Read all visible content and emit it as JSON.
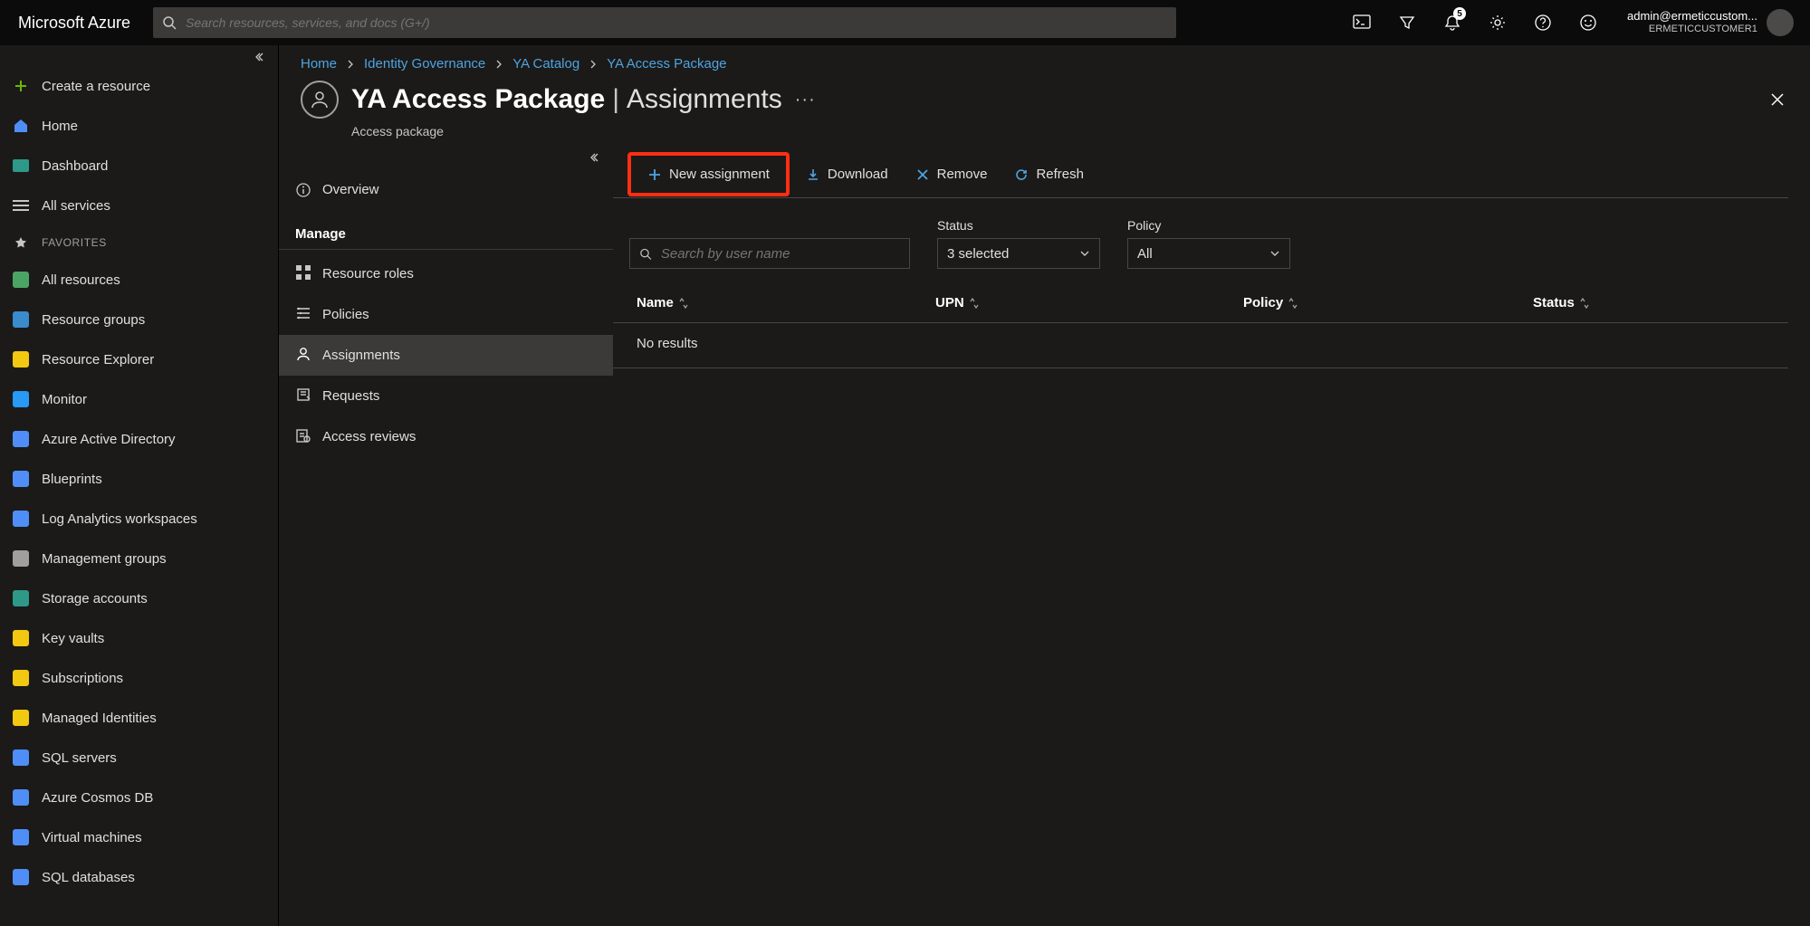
{
  "brand": "Microsoft Azure",
  "search": {
    "placeholder": "Search resources, services, and docs (G+/)"
  },
  "notifications_count": "5",
  "account": {
    "email": "admin@ermeticcustom...",
    "tenant": "ERMETICCUSTOMER1"
  },
  "left_nav": {
    "items_top": [
      {
        "label": "Create a resource",
        "icon": "plus",
        "color": "#6bb700"
      },
      {
        "label": "Home",
        "icon": "home",
        "color": "#4f8ef7"
      },
      {
        "label": "Dashboard",
        "icon": "dash",
        "color": "#2e9989"
      },
      {
        "label": "All services",
        "icon": "list",
        "color": "#c8c6c4"
      }
    ],
    "favorites_label": "FAVORITES",
    "favorites": [
      {
        "label": "All resources",
        "color": "#4aa564"
      },
      {
        "label": "Resource groups",
        "color": "#3a8ccc"
      },
      {
        "label": "Resource Explorer",
        "color": "#f2c811"
      },
      {
        "label": "Monitor",
        "color": "#2899f5"
      },
      {
        "label": "Azure Active Directory",
        "color": "#4f8ef7"
      },
      {
        "label": "Blueprints",
        "color": "#4f8ef7"
      },
      {
        "label": "Log Analytics workspaces",
        "color": "#4f8ef7"
      },
      {
        "label": "Management groups",
        "color": "#a19f9d"
      },
      {
        "label": "Storage accounts",
        "color": "#2e9989"
      },
      {
        "label": "Key vaults",
        "color": "#f2c811"
      },
      {
        "label": "Subscriptions",
        "color": "#f2c811"
      },
      {
        "label": "Managed Identities",
        "color": "#f2c811"
      },
      {
        "label": "SQL servers",
        "color": "#4f8ef7"
      },
      {
        "label": "Azure Cosmos DB",
        "color": "#4f8ef7"
      },
      {
        "label": "Virtual machines",
        "color": "#4f8ef7"
      },
      {
        "label": "SQL databases",
        "color": "#4f8ef7"
      }
    ]
  },
  "breadcrumbs": [
    {
      "label": "Home"
    },
    {
      "label": "Identity Governance"
    },
    {
      "label": "YA Catalog"
    },
    {
      "label": "YA Access Package"
    }
  ],
  "title": {
    "name": "YA Access Package",
    "section": "Assignments",
    "subtitle": "Access package",
    "more": "···"
  },
  "blade_nav": {
    "overview": "Overview",
    "manage_label": "Manage",
    "items": [
      {
        "label": "Resource roles",
        "key": "resource-roles"
      },
      {
        "label": "Policies",
        "key": "policies"
      },
      {
        "label": "Assignments",
        "key": "assignments",
        "selected": true
      },
      {
        "label": "Requests",
        "key": "requests"
      },
      {
        "label": "Access reviews",
        "key": "access-reviews"
      }
    ]
  },
  "toolbar": {
    "new_assignment": "New assignment",
    "download": "Download",
    "remove": "Remove",
    "refresh": "Refresh"
  },
  "filters": {
    "search_placeholder": "Search by user name",
    "status_label": "Status",
    "status_value": "3 selected",
    "policy_label": "Policy",
    "policy_value": "All"
  },
  "table": {
    "columns": {
      "name": "Name",
      "upn": "UPN",
      "policy": "Policy",
      "status": "Status"
    },
    "empty": "No results"
  }
}
